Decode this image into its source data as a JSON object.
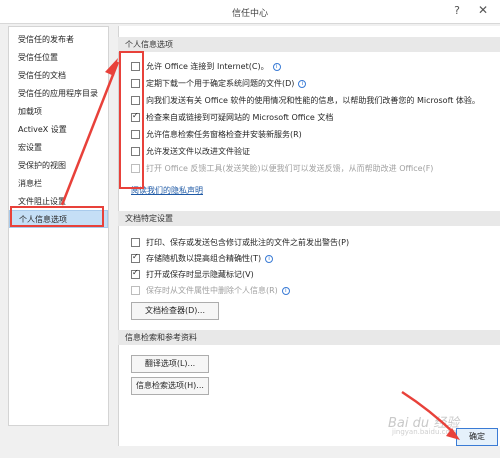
{
  "window": {
    "title": "信任中心",
    "help_glyph": "?",
    "close_glyph": "✕"
  },
  "sidebar": {
    "items": [
      {
        "label": "受信任的发布者"
      },
      {
        "label": "受信任位置"
      },
      {
        "label": "受信任的文档"
      },
      {
        "label": "受信任的应用程序目录"
      },
      {
        "label": "加载项"
      },
      {
        "label": "ActiveX 设置"
      },
      {
        "label": "宏设置"
      },
      {
        "label": "受保护的视图"
      },
      {
        "label": "消息栏"
      },
      {
        "label": "文件阻止设置"
      },
      {
        "label": "个人信息选项"
      }
    ],
    "selected_index": 10
  },
  "personal": {
    "header": "个人信息选项",
    "options": [
      {
        "label": "允许 Office 连接到 Internet(C)。",
        "checked": false,
        "info": true,
        "disabled": false
      },
      {
        "label": "定期下载一个用于确定系统问题的文件(D)",
        "checked": false,
        "info": true,
        "disabled": false
      },
      {
        "label": "向我们发送有关 Office 软件的使用情况和性能的信息，以帮助我们改善您的 Microsoft 体验。",
        "checked": false,
        "info": false,
        "disabled": false
      },
      {
        "label": "检查来自或链接到可疑网站的 Microsoft Office 文档",
        "checked": true,
        "info": false,
        "disabled": false
      },
      {
        "label": "允许信息检索任务窗格检查并安装新服务(R)",
        "checked": false,
        "info": false,
        "disabled": false
      },
      {
        "label": "允许发送文件以改进文件验证",
        "checked": false,
        "info": false,
        "disabled": false
      },
      {
        "label": "打开 Office 反馈工具(发送笑脸)以便我们可以发送反馈，从而帮助改进 Office(F)",
        "checked": false,
        "info": false,
        "disabled": true
      }
    ],
    "privacy_link": "阅读我们的隐私声明"
  },
  "document": {
    "header": "文档特定设置",
    "options": [
      {
        "label": "打印、保存或发送包含修订或批注的文件之前发出警告(P)",
        "checked": false,
        "disabled": false
      },
      {
        "label": "存储随机数以提高组合精确性(T)",
        "checked": true,
        "info": true,
        "disabled": false
      },
      {
        "label": "打开或保存时显示隐藏标记(V)",
        "checked": true,
        "disabled": false
      },
      {
        "label": "保存时从文件属性中删除个人信息(R)",
        "checked": false,
        "info": true,
        "disabled": true
      }
    ],
    "inspector_button": "文档检查器(D)..."
  },
  "research": {
    "header": "信息检索和参考资料",
    "translate_button": "翻译选项(L)...",
    "research_button": "信息检索选项(H)..."
  },
  "footer": {
    "ok_button": "确定"
  },
  "annotation": {
    "color": "#e8413a"
  },
  "watermark": {
    "text": "Bai du 经验",
    "sub": "jingyan.baidu.com"
  }
}
